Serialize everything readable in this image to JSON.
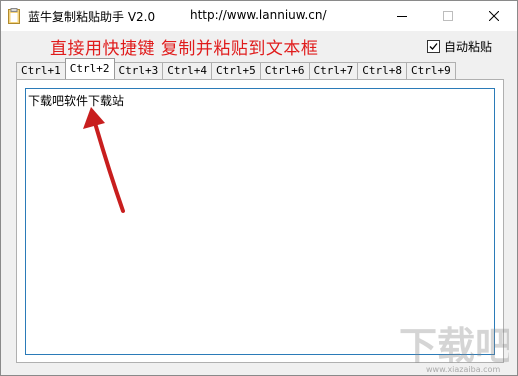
{
  "window": {
    "title": "蓝牛复制粘贴助手 V2.0",
    "url": "http://www.lanniuw.cn/"
  },
  "banner": {
    "text": "直接用快捷键 复制并粘贴到文本框",
    "color": "#e01c1c"
  },
  "auto_paste": {
    "label": "自动粘贴",
    "checked": true
  },
  "tabs": [
    {
      "label": "Ctrl+1",
      "active": false
    },
    {
      "label": "Ctrl+2",
      "active": true
    },
    {
      "label": "Ctrl+3",
      "active": false
    },
    {
      "label": "Ctrl+4",
      "active": false
    },
    {
      "label": "Ctrl+5",
      "active": false
    },
    {
      "label": "Ctrl+6",
      "active": false
    },
    {
      "label": "Ctrl+7",
      "active": false
    },
    {
      "label": "Ctrl+8",
      "active": false
    },
    {
      "label": "Ctrl+9",
      "active": false
    }
  ],
  "editor": {
    "content": "下载吧软件下载站"
  },
  "watermark": {
    "url": "www.xiazaiba.com"
  },
  "icons": {
    "app": "clipboard-icon",
    "minimize": "minimize-icon",
    "maximize": "maximize-icon",
    "close": "close-icon",
    "annotation": "red-arrow-icon"
  },
  "colors": {
    "accent_border": "#2b7bb8",
    "arrow": "#c81e1e"
  }
}
